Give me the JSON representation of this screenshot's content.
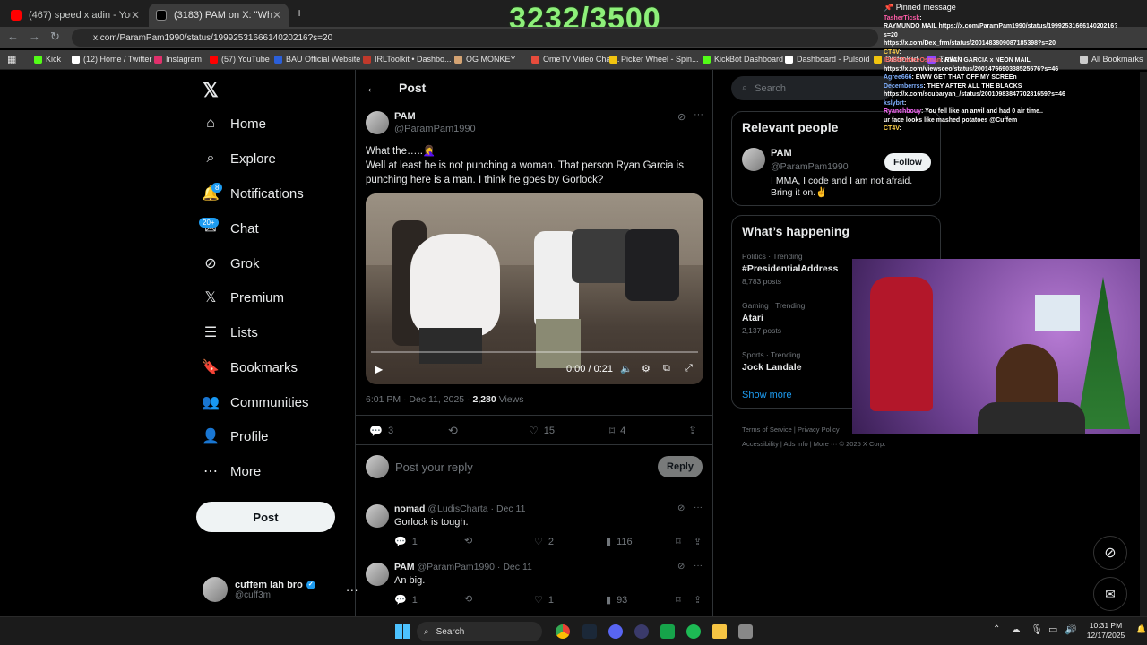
{
  "tabs": [
    {
      "title": "(467) speed x adin - YouTube",
      "color": "#ff0000"
    },
    {
      "title": "(3183) PAM on X: \"What the...",
      "color": "#ffffff"
    }
  ],
  "omnibox": {
    "url": "x.com/ParamPam1990/status/1999253166614020216?s=20"
  },
  "bookmarks": [
    {
      "label": "Kick",
      "color": "#53fc18"
    },
    {
      "label": "(12) Home / Twitter",
      "color": "#ffffff"
    },
    {
      "label": "Instagram",
      "color": "#e1306c"
    },
    {
      "label": "(57) YouTube",
      "color": "#ff0000"
    },
    {
      "label": "BAU Official Website",
      "color": "#2b5fd9"
    },
    {
      "label": "IRLToolkit • Dashbo...",
      "color": "#c0392b"
    },
    {
      "label": "OG MONKEY",
      "color": "#d4a373"
    },
    {
      "label": "OmeTV Video Chat...",
      "color": "#e74c3c"
    },
    {
      "label": "Picker Wheel - Spin...",
      "color": "#f1c40f"
    },
    {
      "label": "KickBot Dashboard",
      "color": "#53fc18"
    },
    {
      "label": "Dashboard - Pulsoid",
      "color": "#ffffff"
    },
    {
      "label": "DistroKid",
      "color": "#f1c40f"
    },
    {
      "label": "Twitch",
      "color": "#9146ff"
    },
    {
      "label": "All Bookmarks",
      "color": "#cccccc"
    }
  ],
  "overlay_counter": "3232/3500",
  "nav": {
    "items": [
      {
        "label": "Home",
        "icon": "home-icon",
        "glyph": "⌂"
      },
      {
        "label": "Explore",
        "icon": "search-icon",
        "glyph": "⌕"
      },
      {
        "label": "Notifications",
        "icon": "bell-icon",
        "glyph": "🔔"
      },
      {
        "label": "Chat",
        "icon": "mail-icon",
        "glyph": "✉"
      },
      {
        "label": "Grok",
        "icon": "grok-icon",
        "glyph": "⊘"
      },
      {
        "label": "Premium",
        "icon": "x-icon",
        "glyph": "𝕏"
      },
      {
        "label": "Lists",
        "icon": "list-icon",
        "glyph": "☰"
      },
      {
        "label": "Bookmarks",
        "icon": "bookmark-icon",
        "glyph": "🔖"
      },
      {
        "label": "Communities",
        "icon": "people-icon",
        "glyph": "👥"
      },
      {
        "label": "Profile",
        "icon": "person-icon",
        "glyph": "👤"
      },
      {
        "label": "More",
        "icon": "more-icon",
        "glyph": "⋯"
      }
    ],
    "notif_badge": "8",
    "chat_badge": "20+",
    "post_label": "Post",
    "me_name": "cuffem lah bro",
    "me_handle": "@cuff3m"
  },
  "post": {
    "header": "Post",
    "name": "PAM",
    "handle": "@ParamPam1990",
    "text_line1": "What the…..🤦‍♀️",
    "text_line2": "Well at least he is not punching a woman. That person Ryan Garcia is punching here is a man. I think he goes by Gorlock?",
    "video_time": "0:00 / 0:21",
    "meta_time": "6:01 PM · Dec 11, 2025 · ",
    "views_count": "2,280",
    "views_label": " Views",
    "replies": "3",
    "likes": "15",
    "bookmarks": "4",
    "reply_placeholder": "Post your reply",
    "reply_button": "Reply"
  },
  "replies": [
    {
      "name": "nomad",
      "handle": "@LudisCharta · Dec 11",
      "text": "Gorlock is tough.",
      "replies": "1",
      "likes": "2",
      "views": "116"
    },
    {
      "name": "PAM",
      "handle": "@ParamPam1990 · Dec 11",
      "text": "An big.",
      "replies": "1",
      "likes": "1",
      "views": "93"
    }
  ],
  "right": {
    "search_placeholder": "Search",
    "relevant_title": "Relevant people",
    "person_name": "PAM",
    "person_handle": "@ParamPam1990",
    "person_bio": "I MMA, I code and I am not afraid.",
    "person_bio2": "Bring it on.✌️",
    "follow_label": "Follow",
    "happening_title": "What’s happening",
    "trends": [
      {
        "context": "Politics · Trending",
        "name": "#PresidentialAddress",
        "posts": "8,783 posts"
      },
      {
        "context": "Gaming · Trending",
        "name": "Atari",
        "posts": "2,137 posts"
      },
      {
        "context": "Sports · Trending",
        "name": "Jock Landale",
        "posts": ""
      }
    ],
    "show_more": "Show more",
    "footer1": "Terms of Service   |   Privacy Policy",
    "footer2": "Accessibility  |  Ads info  |  More ···   © 2025 X Corp."
  },
  "chat": {
    "pinned": "Pinned message",
    "lines": [
      {
        "user": "TasherTicsk",
        "color": "#ff5ca8",
        "msg": ":"
      },
      {
        "user": "",
        "color": "#ffffff",
        "msg": "RAYMUNDO MAIL https://x.com/ParamPam1990/status/1999253166614020216?"
      },
      {
        "user": "",
        "color": "#ffffff",
        "msg": "s=20"
      },
      {
        "user": "",
        "color": "#ffffff",
        "msg": "https://x.com/Dex_frm/status/2001483809087185398?s=20"
      },
      {
        "user": "CT4V",
        "color": "#ffd24d",
        "msg": ":"
      },
      {
        "user": "IBelloParteeOsman",
        "color": "#ff6a6a",
        "msg": ": RYAN GARCIA x NEON MAIL"
      },
      {
        "user": "",
        "color": "#ffffff",
        "msg": "https://x.com/viewsceo/status/2001476690338525576?s=46"
      },
      {
        "user": "Agree666",
        "color": "#7fb0ff",
        "msg": ": EWW GET THAT OFF MY SCREEn"
      },
      {
        "user": "Decemberrss",
        "color": "#7fb0ff",
        "msg": ": THEY AFTER ALL THE BLACKS"
      },
      {
        "user": "",
        "color": "#ffffff",
        "msg": "https://x.com/scubaryan_/status/2001098384770281659?s=46"
      },
      {
        "user": "kslybrt",
        "color": "#7fb0ff",
        "msg": ":"
      },
      {
        "user": "Ryanchbouy",
        "color": "#ff6aff",
        "msg": ": You fell like an anvil and had 0 air time.."
      },
      {
        "user": "",
        "color": "#ffffff",
        "msg": ""
      },
      {
        "user": "",
        "color": "#ffffff",
        "msg": "ur face looks like mashed potatoes @Cuffem"
      },
      {
        "user": "",
        "color": "#ffffff",
        "msg": ""
      },
      {
        "user": "CT4V",
        "color": "#ffd24d",
        "msg": ":"
      }
    ]
  },
  "taskbar": {
    "search": "Search",
    "time": "10:31 PM",
    "date": "12/17/2025"
  }
}
